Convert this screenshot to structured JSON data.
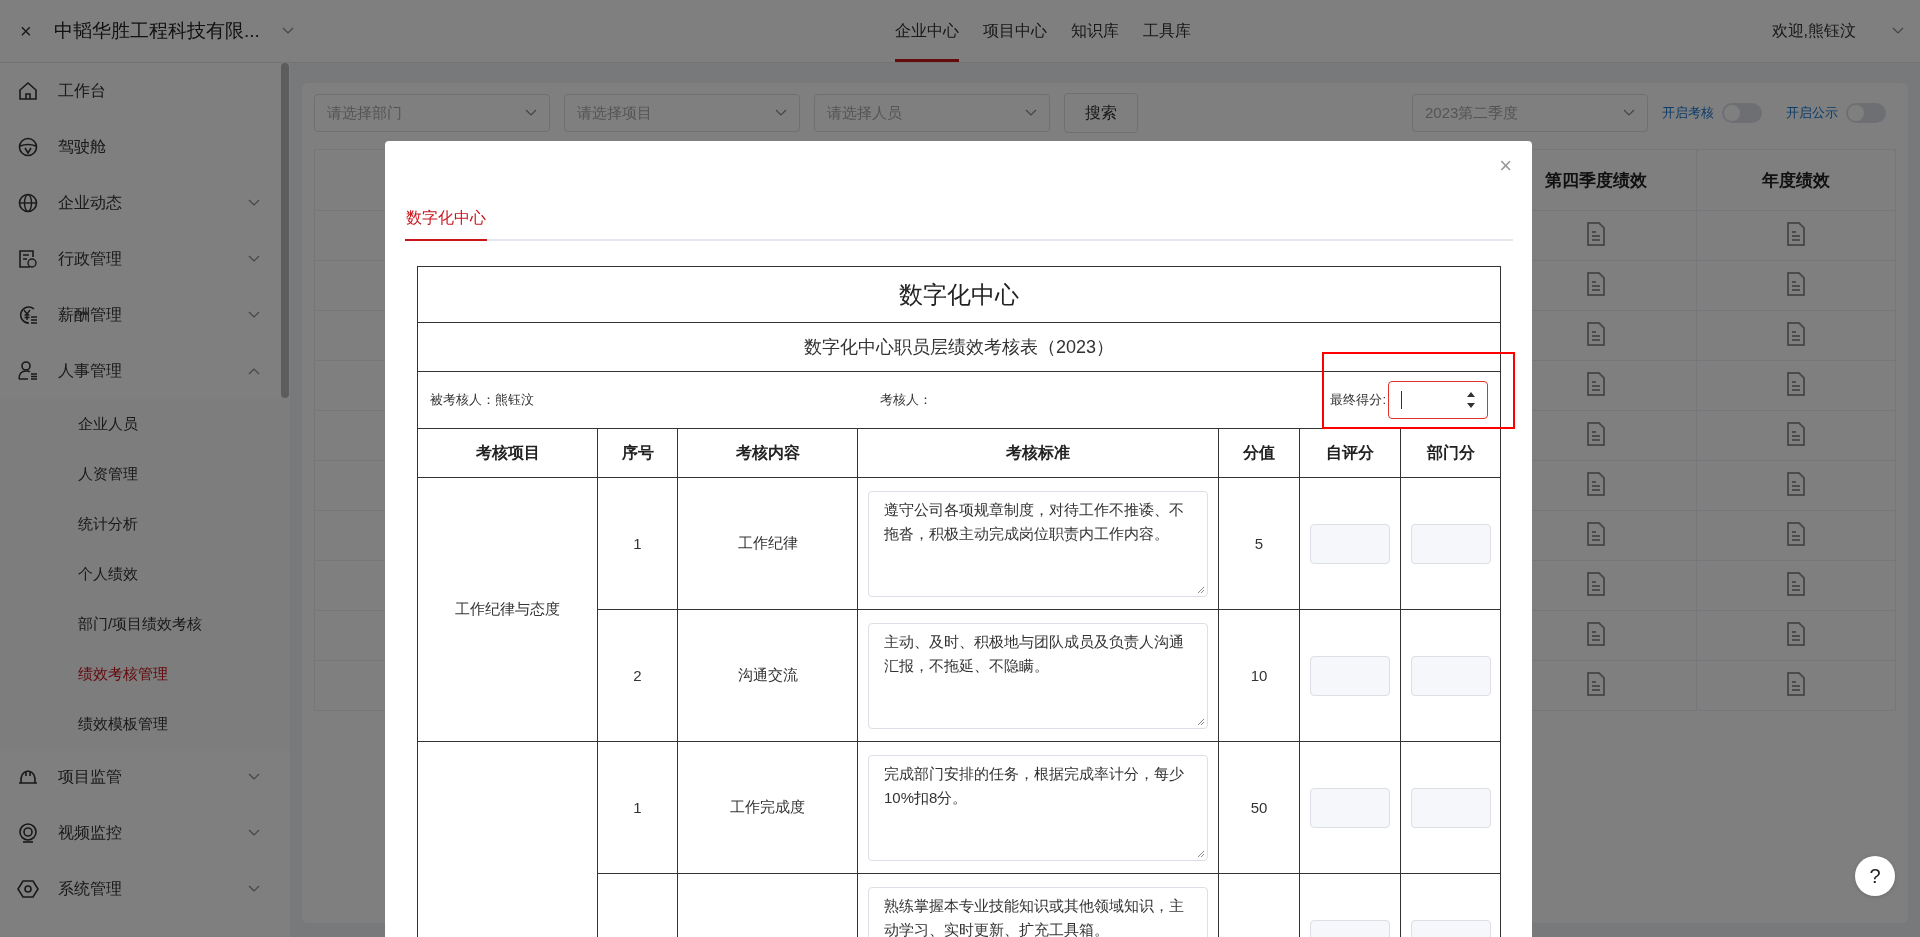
{
  "header": {
    "close_glyph": "×",
    "company": "中韬华胜工程科技有限...",
    "user": "欢迎,熊钰汶"
  },
  "nav_tabs": [
    {
      "label": "企业中心",
      "selected": true
    },
    {
      "label": "项目中心",
      "selected": false
    },
    {
      "label": "知识库",
      "selected": false
    },
    {
      "label": "工具库",
      "selected": false
    }
  ],
  "sidebar": {
    "items": [
      {
        "label": "工作台",
        "selected": false
      },
      {
        "label": "驾驶舱",
        "selected": false
      },
      {
        "label": "企业动态",
        "selected": false,
        "expanded": false
      },
      {
        "label": "行政管理",
        "selected": false,
        "expanded": false
      },
      {
        "label": "薪酬管理",
        "selected": false,
        "expanded": false
      },
      {
        "label": "人事管理",
        "selected": false,
        "expanded": true,
        "children": [
          {
            "label": "企业人员",
            "selected": false
          },
          {
            "label": "人资管理",
            "selected": false
          },
          {
            "label": "统计分析",
            "selected": false
          },
          {
            "label": "个人绩效",
            "selected": false
          },
          {
            "label": "部门/项目绩效考核",
            "selected": false
          },
          {
            "label": "绩效考核管理",
            "selected": true
          },
          {
            "label": "绩效模板管理",
            "selected": false
          }
        ]
      },
      {
        "label": "项目监管",
        "selected": false,
        "expanded": false
      },
      {
        "label": "视频监控",
        "selected": false,
        "expanded": false
      },
      {
        "label": "系统管理",
        "selected": false,
        "expanded": false
      }
    ]
  },
  "filters": {
    "selects": [
      {
        "placeholder": "请选择部门"
      },
      {
        "placeholder": "请选择项目"
      },
      {
        "placeholder": "请选择人员"
      }
    ],
    "search_button": "搜索",
    "quarter": {
      "value": "2023第二季度"
    },
    "toggles": [
      {
        "label": "开启考核",
        "on": false
      },
      {
        "label": "开启公示",
        "on": false
      }
    ]
  },
  "background_table": {
    "columns": [
      "第四季度绩效",
      "年度绩效"
    ],
    "rows": [
      {
        "cells": [
          {
            "kind": "document"
          },
          {
            "kind": "document"
          }
        ]
      },
      {
        "cells": [
          {
            "kind": "document"
          },
          {
            "kind": "document"
          }
        ]
      },
      {
        "cells": [
          {
            "kind": "document"
          },
          {
            "kind": "document"
          }
        ]
      },
      {
        "cells": [
          {
            "kind": "document"
          },
          {
            "kind": "document"
          }
        ]
      },
      {
        "cells": [
          {
            "kind": "document"
          },
          {
            "kind": "document"
          }
        ]
      },
      {
        "cells": [
          {
            "kind": "document"
          },
          {
            "kind": "document"
          }
        ]
      },
      {
        "cells": [
          {
            "kind": "document"
          },
          {
            "kind": "document"
          }
        ]
      },
      {
        "cells": [
          {
            "kind": "document"
          },
          {
            "kind": "document"
          }
        ]
      },
      {
        "cells": [
          {
            "kind": "document"
          },
          {
            "kind": "document"
          }
        ]
      },
      {
        "cells": [
          {
            "kind": "document"
          },
          {
            "kind": "document"
          }
        ]
      }
    ]
  },
  "modal": {
    "close_glyph": "×",
    "tabs": [
      {
        "label": "数字化中心",
        "selected": true
      }
    ],
    "form": {
      "title": "数字化中心",
      "subtitle": "数字化中心职员层绩效考核表（2023）",
      "assessee": "被考核人：熊钰汶",
      "assessor": "考核人：",
      "final_score": {
        "label": "最终得分:",
        "focused": true,
        "highlighted": true
      },
      "columns": [
        "考核项目",
        "序号",
        "考核内容",
        "考核标准",
        "分值",
        "自评分",
        "部门分"
      ],
      "groups": [
        {
          "category": "工作纪律与态度",
          "items": [
            {
              "no": "1",
              "content": "工作纪律",
              "standard": "遵守公司各项规章制度，对待工作不推诿、不拖沓，积极主动完成岗位职责内工作内容。",
              "score": "5"
            },
            {
              "no": "2",
              "content": "沟通交流",
              "standard": "主动、及时、积极地与团队成员及负责人沟通汇报，不拖延、不隐瞒。",
              "score": "10"
            }
          ]
        },
        {
          "items": [
            {
              "no": "1",
              "content": "工作完成度",
              "standard": "完成部门安排的任务，根据完成率计分，每少10%扣8分。",
              "score": "50"
            },
            {
              "standard": "熟练掌握本专业技能知识或其他领域知识，主动学习、实时更新、扩充工具箱。"
            }
          ]
        }
      ]
    }
  },
  "help_button": "?"
}
